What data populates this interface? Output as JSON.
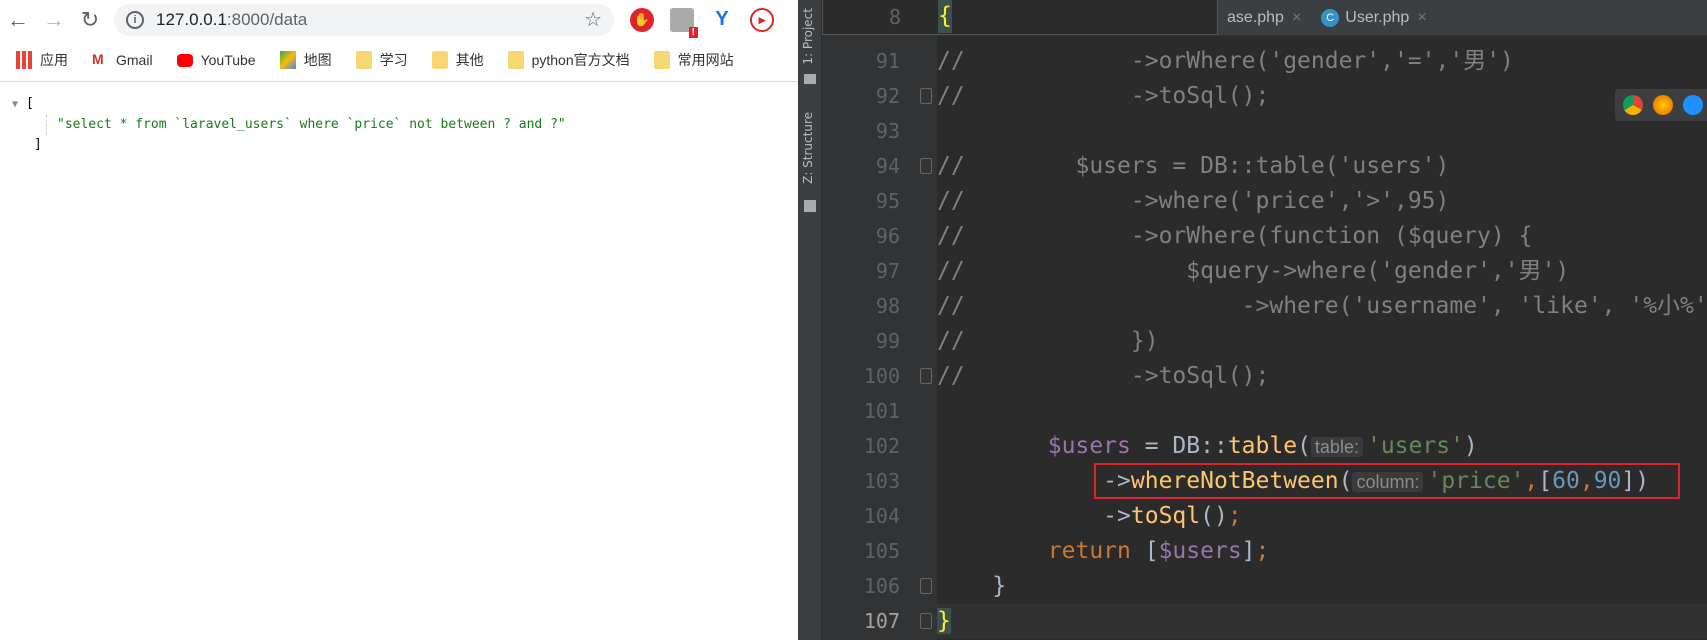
{
  "browser": {
    "url_host": "127.0.0.1",
    "url_path": ":8000/data",
    "bookmarks": [
      {
        "label": "应用",
        "icon": "apps-grid-icon"
      },
      {
        "label": "Gmail",
        "icon": "gmail-icon"
      },
      {
        "label": "YouTube",
        "icon": "youtube-icon"
      },
      {
        "label": "地图",
        "icon": "maps-icon"
      },
      {
        "label": "学习",
        "icon": "folder-icon"
      },
      {
        "label": "其他",
        "icon": "folder-icon"
      },
      {
        "label": "python官方文档",
        "icon": "folder-icon"
      },
      {
        "label": "常用网站",
        "icon": "folder-icon"
      }
    ],
    "json_open": "[",
    "json_value": "\"select * from `laravel_users` where `price` not between ? and ?\"",
    "json_close": "]",
    "ext_badge": "!"
  },
  "ide": {
    "tool_windows": [
      "1: Project",
      "Z: Structure"
    ],
    "tabs": [
      {
        "label": "ase.php",
        "icon": ""
      },
      {
        "label": "User.php",
        "icon": "C"
      }
    ],
    "sticky": {
      "line": "8",
      "text": "{"
    },
    "highlight_color": "#e0242b",
    "current_line": "107",
    "lines": [
      {
        "n": "91",
        "t": [
          [
            "//",
            "cm"
          ],
          [
            "            ->orWhere('gender','=','男')",
            "cm"
          ]
        ]
      },
      {
        "n": "92",
        "t": [
          [
            "//",
            "cm"
          ],
          [
            "            ->toSql();",
            "cm"
          ]
        ]
      },
      {
        "n": "93",
        "t": []
      },
      {
        "n": "94",
        "t": [
          [
            "//",
            "cm"
          ],
          [
            "        $users = DB::table('users')",
            "cm"
          ]
        ]
      },
      {
        "n": "95",
        "t": [
          [
            "//",
            "cm"
          ],
          [
            "            ->where('price','>',95)",
            "cm"
          ]
        ]
      },
      {
        "n": "96",
        "t": [
          [
            "//",
            "cm"
          ],
          [
            "            ->orWhere(function ($query) {",
            "cm"
          ]
        ]
      },
      {
        "n": "97",
        "t": [
          [
            "//",
            "cm"
          ],
          [
            "                $query->where('gender','男')",
            "cm"
          ]
        ]
      },
      {
        "n": "98",
        "t": [
          [
            "//",
            "cm"
          ],
          [
            "                    ->where('username', 'like', '%小%')",
            "cm"
          ]
        ]
      },
      {
        "n": "99",
        "t": [
          [
            "//",
            "cm"
          ],
          [
            "            })",
            "cm"
          ]
        ]
      },
      {
        "n": "100",
        "t": [
          [
            "//",
            "cm"
          ],
          [
            "            ->toSql();",
            "cm"
          ]
        ]
      },
      {
        "n": "101",
        "t": []
      },
      {
        "n": "102",
        "t": [
          [
            "        ",
            ""
          ],
          [
            "$users",
            "var"
          ],
          [
            " = DB::",
            ""
          ],
          [
            "table",
            "fn"
          ],
          [
            "(",
            ""
          ],
          [
            "table:",
            "hint"
          ],
          [
            "'users'",
            "st"
          ],
          [
            ")",
            ""
          ]
        ]
      },
      {
        "n": "103",
        "t": [
          [
            "            ->",
            ""
          ],
          [
            "whereNotBetween",
            "fn"
          ],
          [
            "(",
            ""
          ],
          [
            "column:",
            "hint"
          ],
          [
            "'price'",
            "st"
          ],
          [
            ",",
            "kw"
          ],
          [
            "[",
            ""
          ],
          [
            "60",
            "num"
          ],
          [
            ",",
            "kw"
          ],
          [
            "90",
            "num"
          ],
          [
            "])",
            ""
          ]
        ]
      },
      {
        "n": "104",
        "t": [
          [
            "            ->",
            ""
          ],
          [
            "toSql",
            "fn"
          ],
          [
            "()",
            ""
          ],
          [
            ";",
            "kw"
          ]
        ]
      },
      {
        "n": "105",
        "t": [
          [
            "        ",
            ""
          ],
          [
            "return",
            "kw"
          ],
          [
            " [",
            ""
          ],
          [
            "$users",
            "var"
          ],
          [
            "]",
            ""
          ],
          [
            ";",
            "kw"
          ]
        ]
      },
      {
        "n": "106",
        "t": [
          [
            "    }",
            ""
          ]
        ]
      },
      {
        "n": "107",
        "t": [
          [
            "}",
            "br"
          ]
        ]
      }
    ]
  }
}
